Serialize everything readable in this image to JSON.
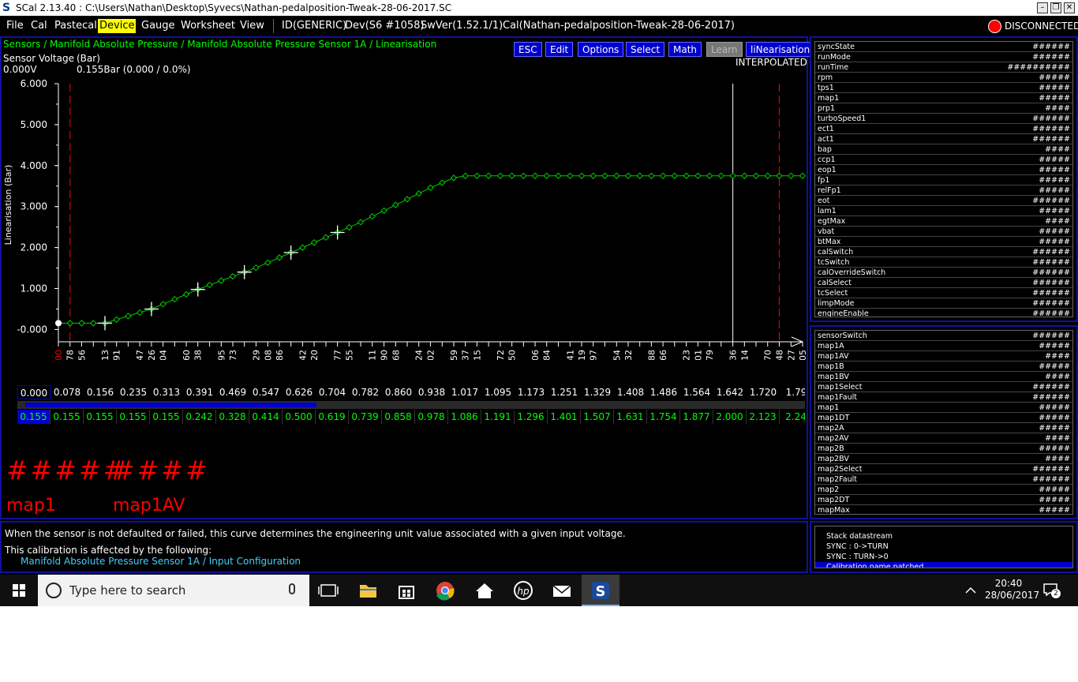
{
  "window": {
    "icon_letter": "S",
    "title": "SCal 2.13.40  :  C:\\Users\\Nathan\\Desktop\\Syvecs\\Nathan-pedalposition-Tweak-28-06-2017.SC"
  },
  "menu": {
    "items": [
      "File",
      "Cal",
      "Pastecal",
      "Device",
      "Gauge",
      "Worksheet",
      "View"
    ],
    "active": "Device",
    "id": "ID(GENERIC)",
    "dev": "Dev(S6 #1058)",
    "swver": "SwVer(1.52.1/1)",
    "cal": "Cal(Nathan-pedalposition-Tweak-28-06-2017)",
    "status": "DISCONNECTED",
    "status_color": "#ff0000"
  },
  "main": {
    "breadcrumb": "Sensors / Manifold Absolute Pressure / Manifold Absolute Pressure Sensor 1A / Linearisation",
    "buttons": [
      {
        "label": "ESC",
        "enabled": true
      },
      {
        "label": "Edit",
        "enabled": true
      },
      {
        "label": "Options",
        "enabled": true
      },
      {
        "label": "Select",
        "enabled": true
      },
      {
        "label": "Math",
        "enabled": true
      },
      {
        "label": "Learn",
        "enabled": false
      },
      {
        "label": "liNearisation",
        "enabled": true
      }
    ],
    "mode": "INTERPOLATED",
    "sensor_voltage_label": "Sensor Voltage",
    "sensor_voltage_value": "0.000V",
    "bar_unit": "(Bar)",
    "bar_value": "0.155Bar (0.000 / 0.0%)"
  },
  "chart_data": {
    "type": "line",
    "xlabel": "map1AV",
    "ylabel": "Linearisation (Bar)",
    "ylim": [
      -0.3,
      6.0
    ],
    "xlim": [
      0.0,
      5.005
    ],
    "yticks": [
      "6.000",
      "5.000",
      "4.000",
      "3.000",
      "2.000",
      "1.000",
      "-0.000"
    ],
    "xticks": [
      "0.000",
      "0.078",
      "0.156",
      "0.313",
      "0.391",
      "0.547",
      "0.626",
      "0.704",
      "0.860",
      "0.938",
      "1.095",
      "1.173",
      "1.329",
      "1.408",
      "1.486",
      "1.642",
      "1.720",
      "1.877",
      "1.955",
      "2.111",
      "2.190",
      "2.268",
      "2.424",
      "2.502",
      "2.659",
      "2.737",
      "2.815",
      "2.972",
      "3.050",
      "3.206",
      "3.284",
      "3.441",
      "3.519",
      "3.597",
      "3.754",
      "3.832",
      "3.988",
      "4.066",
      "4.223",
      "4.301",
      "4.379",
      "4.536",
      "4.614",
      "4.770",
      "4.848",
      "4.927",
      "5.005"
    ],
    "grid": false,
    "series_color": "#00cc00",
    "x": [
      0.0,
      0.078,
      0.156,
      0.235,
      0.313,
      0.391,
      0.469,
      0.547,
      0.626,
      0.704,
      0.782,
      0.86,
      0.938,
      1.017,
      1.095,
      1.173,
      1.251,
      1.329,
      1.408,
      1.486,
      1.564,
      1.642,
      1.72,
      1.799,
      1.877,
      1.955,
      2.033,
      2.111,
      2.19,
      2.268,
      2.346,
      2.424,
      2.502,
      2.581,
      2.659,
      2.737,
      2.815,
      2.893,
      2.972,
      3.05,
      3.128,
      3.206,
      3.284,
      3.362,
      3.441,
      3.519,
      3.597,
      3.675,
      3.754,
      3.832,
      3.91,
      3.988,
      4.066,
      4.144,
      4.223,
      4.301,
      4.379,
      4.457,
      4.536,
      4.614,
      4.692,
      4.77,
      4.848,
      4.927,
      5.005
    ],
    "values": [
      0.155,
      0.155,
      0.155,
      0.155,
      0.155,
      0.242,
      0.328,
      0.414,
      0.5,
      0.619,
      0.739,
      0.858,
      0.978,
      1.086,
      1.191,
      1.296,
      1.401,
      1.507,
      1.631,
      1.754,
      1.877,
      2.0,
      2.123,
      2.246,
      2.369,
      2.492,
      2.62,
      2.76,
      2.9,
      3.04,
      3.18,
      3.32,
      3.46,
      3.58,
      3.7,
      3.75,
      3.75,
      3.75,
      3.75,
      3.75,
      3.75,
      3.75,
      3.75,
      3.75,
      3.75,
      3.75,
      3.75,
      3.75,
      3.75,
      3.75,
      3.75,
      3.75,
      3.75,
      3.75,
      3.75,
      3.75,
      3.75,
      3.75,
      3.75,
      3.75,
      3.75,
      3.75,
      3.75,
      3.75,
      3.75
    ],
    "marked_points": [
      0.313,
      0.626,
      0.938,
      1.251,
      1.564,
      1.877
    ],
    "cursor_x": 4.536,
    "limit_lines_x": [
      0.078,
      4.848
    ],
    "current_point": {
      "x": 0.0,
      "y": 0.155
    }
  },
  "table": {
    "x_values": [
      "0.000",
      "0.078",
      "0.156",
      "0.235",
      "0.313",
      "0.391",
      "0.469",
      "0.547",
      "0.626",
      "0.704",
      "0.782",
      "0.860",
      "0.938",
      "1.017",
      "1.095",
      "1.173",
      "1.251",
      "1.329",
      "1.408",
      "1.486",
      "1.564",
      "1.642",
      "1.720",
      "1.79"
    ],
    "y_values": [
      "0.155",
      "0.155",
      "0.155",
      "0.155",
      "0.155",
      "0.242",
      "0.328",
      "0.414",
      "0.500",
      "0.619",
      "0.739",
      "0.858",
      "0.978",
      "1.086",
      "1.191",
      "1.296",
      "1.401",
      "1.507",
      "1.631",
      "1.754",
      "1.877",
      "2.000",
      "2.123",
      "2.24"
    ],
    "scroll_fraction": 0.37
  },
  "readouts": [
    {
      "value": "#####",
      "name": "map1"
    },
    {
      "value": "####",
      "name": "map1AV"
    }
  ],
  "description": {
    "text": "When the sensor is not defaulted or failed, this curve determines the engineering unit value associated with a given input voltage.",
    "affected_label": "This calibration is affected by the following:",
    "link": "Manifold Absolute Pressure Sensor 1A / Input Configuration"
  },
  "channels_1": [
    {
      "name": "syncState",
      "value": "######"
    },
    {
      "name": "runMode",
      "value": "######"
    },
    {
      "name": "runTime",
      "value": "##########"
    },
    {
      "name": "rpm",
      "value": "#####"
    },
    {
      "name": "tps1",
      "value": "#####"
    },
    {
      "name": "map1",
      "value": "#####"
    },
    {
      "name": "prp1",
      "value": "####"
    },
    {
      "name": "turboSpeed1",
      "value": "######"
    },
    {
      "name": "ect1",
      "value": "######"
    },
    {
      "name": "act1",
      "value": "######"
    },
    {
      "name": "bap",
      "value": "####"
    },
    {
      "name": "ccp1",
      "value": "#####"
    },
    {
      "name": "eop1",
      "value": "#####"
    },
    {
      "name": "fp1",
      "value": "#####"
    },
    {
      "name": "relFp1",
      "value": "#####"
    },
    {
      "name": "eot",
      "value": "######"
    },
    {
      "name": "lam1",
      "value": "#####"
    },
    {
      "name": "egtMax",
      "value": "####"
    },
    {
      "name": "vbat",
      "value": "#####"
    },
    {
      "name": "btMax",
      "value": "#####"
    },
    {
      "name": "calSwitch",
      "value": "######"
    },
    {
      "name": "tcSwitch",
      "value": "######"
    },
    {
      "name": "calOverrideSwitch",
      "value": "######"
    },
    {
      "name": "calSelect",
      "value": "######"
    },
    {
      "name": "tcSelect",
      "value": "######"
    },
    {
      "name": "limpMode",
      "value": "######"
    },
    {
      "name": "engineEnable",
      "value": "######"
    }
  ],
  "channels_2": [
    {
      "name": "sensorSwitch",
      "value": "######"
    },
    {
      "name": "map1A",
      "value": "#####"
    },
    {
      "name": "map1AV",
      "value": "####"
    },
    {
      "name": "map1B",
      "value": "#####"
    },
    {
      "name": "map1BV",
      "value": "####"
    },
    {
      "name": "map1Select",
      "value": "######"
    },
    {
      "name": "map1Fault",
      "value": "######"
    },
    {
      "name": "map1",
      "value": "#####"
    },
    {
      "name": "map1DT",
      "value": "#####"
    },
    {
      "name": "map2A",
      "value": "#####"
    },
    {
      "name": "map2AV",
      "value": "####"
    },
    {
      "name": "map2B",
      "value": "#####"
    },
    {
      "name": "map2BV",
      "value": "####"
    },
    {
      "name": "map2Select",
      "value": "######"
    },
    {
      "name": "map2Fault",
      "value": "######"
    },
    {
      "name": "map2",
      "value": "#####"
    },
    {
      "name": "map2DT",
      "value": "#####"
    },
    {
      "name": "mapMax",
      "value": "#####"
    }
  ],
  "messages": [
    {
      "text": "Stack datastream",
      "selected": false
    },
    {
      "text": "SYNC : 0->TURN",
      "selected": false
    },
    {
      "text": "SYNC : TURN->0",
      "selected": false
    },
    {
      "text": "Calibration name patched",
      "selected": true
    }
  ],
  "taskbar": {
    "search_placeholder": "Type here to search",
    "time": "20:40",
    "date": "28/06/2017",
    "notifications": "2"
  }
}
